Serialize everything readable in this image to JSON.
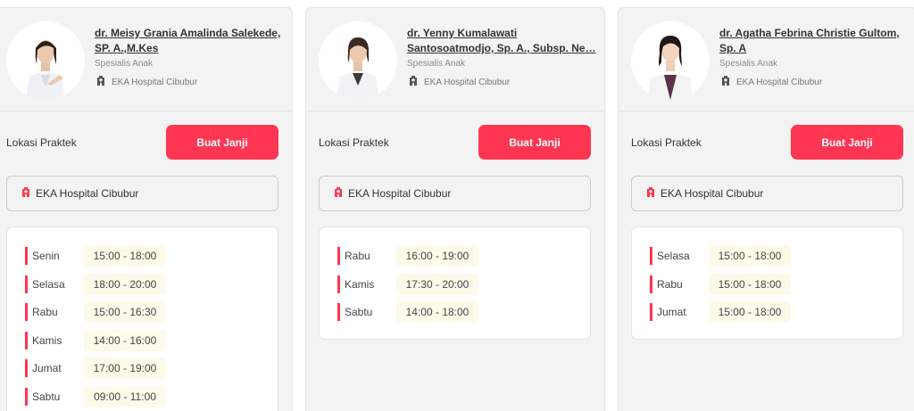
{
  "doctors": [
    {
      "name": "dr. Meisy Grania Amalinda Salekede, SP. A.,M.Kes",
      "specialty": "Spesialis Anak",
      "hospital": "EKA Hospital Cibubur",
      "location_label": "Lokasi Praktek",
      "button_label": "Buat Janji",
      "location_name": "EKA Hospital Cibubur",
      "schedule": [
        {
          "day": "Senin",
          "time": "15:00 - 18:00"
        },
        {
          "day": "Selasa",
          "time": "18:00 - 20:00"
        },
        {
          "day": "Rabu",
          "time": "15:00 - 16:30"
        },
        {
          "day": "Kamis",
          "time": "14:00 - 16:00"
        },
        {
          "day": "Jumat",
          "time": "17:00 - 19:00"
        },
        {
          "day": "Sabtu",
          "time": "09:00 - 11:00"
        }
      ]
    },
    {
      "name": "dr. Yenny Kumalawati Santosoatmodjo, Sp. A., Subsp. Ne…",
      "specialty": "Spesialis Anak",
      "hospital": "EKA Hospital Cibubur",
      "location_label": "Lokasi Praktek",
      "button_label": "Buat Janji",
      "location_name": "EKA Hospital Cibubur",
      "schedule": [
        {
          "day": "Rabu",
          "time": "16:00 - 19:00"
        },
        {
          "day": "Kamis",
          "time": "17:30 - 20:00"
        },
        {
          "day": "Sabtu",
          "time": "14:00 - 18:00"
        }
      ]
    },
    {
      "name": "dr. Agatha Febrina Christie Gultom, Sp. A",
      "specialty": "Spesialis Anak",
      "hospital": "EKA Hospital Cibubur",
      "location_label": "Lokasi Praktek",
      "button_label": "Buat Janji",
      "location_name": "EKA Hospital Cibubur",
      "schedule": [
        {
          "day": "Selasa",
          "time": "15:00 - 18:00"
        },
        {
          "day": "Rabu",
          "time": "15:00 - 18:00"
        },
        {
          "day": "Jumat",
          "time": "15:00 - 18:00"
        }
      ]
    }
  ],
  "colors": {
    "accent": "#fe3652",
    "card_bg": "#f3f3f3",
    "time_bg": "#fdfaea"
  },
  "icons": {
    "hospital": "hospital-building-icon",
    "avatar": "doctor-photo"
  }
}
